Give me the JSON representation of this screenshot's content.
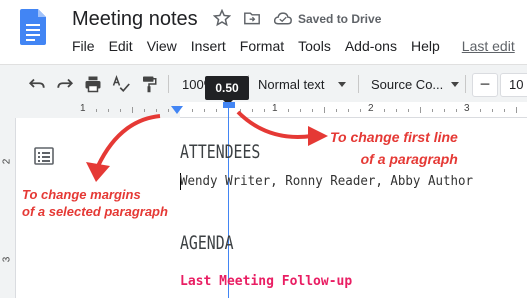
{
  "app": {
    "doc_title": "Meeting notes",
    "save_status": "Saved to Drive",
    "menu": [
      "File",
      "Edit",
      "View",
      "Insert",
      "Format",
      "Tools",
      "Add-ons",
      "Help"
    ],
    "last_edit": "Last edit",
    "icons": {
      "logo": "docs-logo-icon",
      "star": "star-icon",
      "move": "move-to-folder-icon",
      "cloud": "cloud-saved-icon"
    }
  },
  "toolbar": {
    "zoom": "100%",
    "style": "Normal text",
    "font": "Source Co...",
    "font_size": "10",
    "minus": "−"
  },
  "ruler": {
    "numbers": [
      "1",
      "1",
      "2",
      "3"
    ],
    "tooltip": "0.50",
    "vertical_numbers": [
      "2",
      "3"
    ]
  },
  "document": {
    "heading1": "ATTENDEES",
    "attendees": "Wendy Writer, Ronny Reader, Abby Author",
    "heading2": "AGENDA",
    "followup": "Last Meeting Follow-up"
  },
  "annotations": {
    "left_line1": "To change margins",
    "left_line2": "of a selected paragraph",
    "right_line1": "To change first line",
    "right_line2": "of a paragraph"
  },
  "colors": {
    "accent": "#4285f4",
    "annotation": "#e53935",
    "followup": "#e91e63"
  }
}
